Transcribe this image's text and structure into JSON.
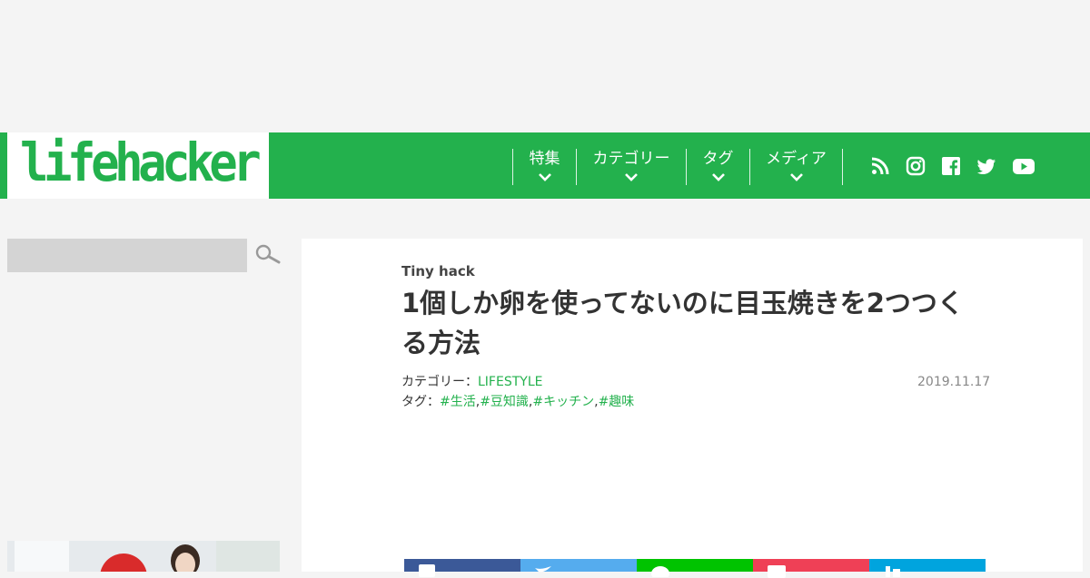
{
  "logo": {
    "text": "lifehacker"
  },
  "nav": {
    "items": [
      {
        "label": "特集"
      },
      {
        "label": "カテゴリー"
      },
      {
        "label": "タグ"
      },
      {
        "label": "メディア"
      }
    ],
    "social_icons": [
      "rss-icon",
      "instagram-icon",
      "facebook-icon",
      "twitter-icon",
      "youtube-icon"
    ]
  },
  "search": {
    "placeholder": ""
  },
  "article": {
    "kicker": "Tiny hack",
    "title": "1個しか卵を使ってないのに目玉焼きを2つつくる方法",
    "category_label": "カテゴリー：",
    "category": "LIFESTYLE",
    "tag_label": "タグ：",
    "tags": [
      "#生活",
      "#豆知識",
      "#キッチン",
      "#趣味"
    ],
    "tag_sep": ",",
    "date": "2019.11.17"
  },
  "share_buttons": [
    {
      "name": "facebook",
      "color": "#3b5998"
    },
    {
      "name": "twitter",
      "color": "#55acee"
    },
    {
      "name": "line",
      "color": "#00c300"
    },
    {
      "name": "pocket",
      "color": "#ef4056"
    },
    {
      "name": "hatena",
      "color": "#00a4de"
    }
  ],
  "colors": {
    "brand": "#23b14d",
    "background": "#f4f4f4"
  }
}
